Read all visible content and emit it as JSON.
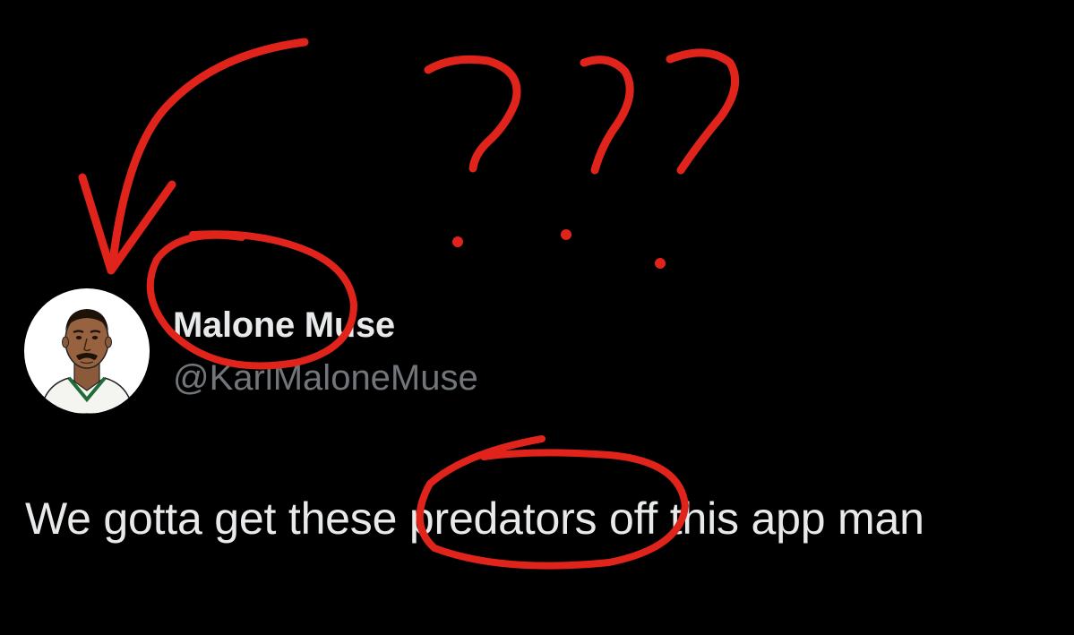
{
  "tweet": {
    "author": {
      "display_name": "Malone Muse",
      "handle": "@KarlMaloneMuse",
      "avatar_icon": "cartoon-portrait-avatar"
    },
    "text": "We gotta get these predators off this app man"
  },
  "annotations": {
    "color": "#e0241b",
    "marks": [
      "curved-arrow",
      "question-marks",
      "name-circle",
      "word-circle"
    ]
  }
}
